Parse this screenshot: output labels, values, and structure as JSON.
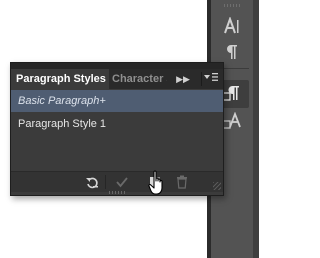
{
  "panel": {
    "tabs": [
      {
        "label": "Paragraph Styles",
        "active": true
      },
      {
        "label": "Character Styles",
        "active": false
      }
    ],
    "styles": [
      {
        "label": "Basic Paragraph+",
        "selected": true
      },
      {
        "label": "Paragraph Style 1",
        "selected": false
      }
    ],
    "footer_buttons": [
      "clear-overrides-icon",
      "redefine-style-icon",
      "create-new-style-icon",
      "delete-icon"
    ]
  },
  "dock": {
    "buttons": [
      "character-icon",
      "paragraph-icon",
      "paragraph-styles-icon",
      "character-styles-icon"
    ]
  },
  "colors": {
    "panel_bg": "#3b3b3b",
    "selected_row": "#4f5d72",
    "dock_bg": "#535353"
  }
}
